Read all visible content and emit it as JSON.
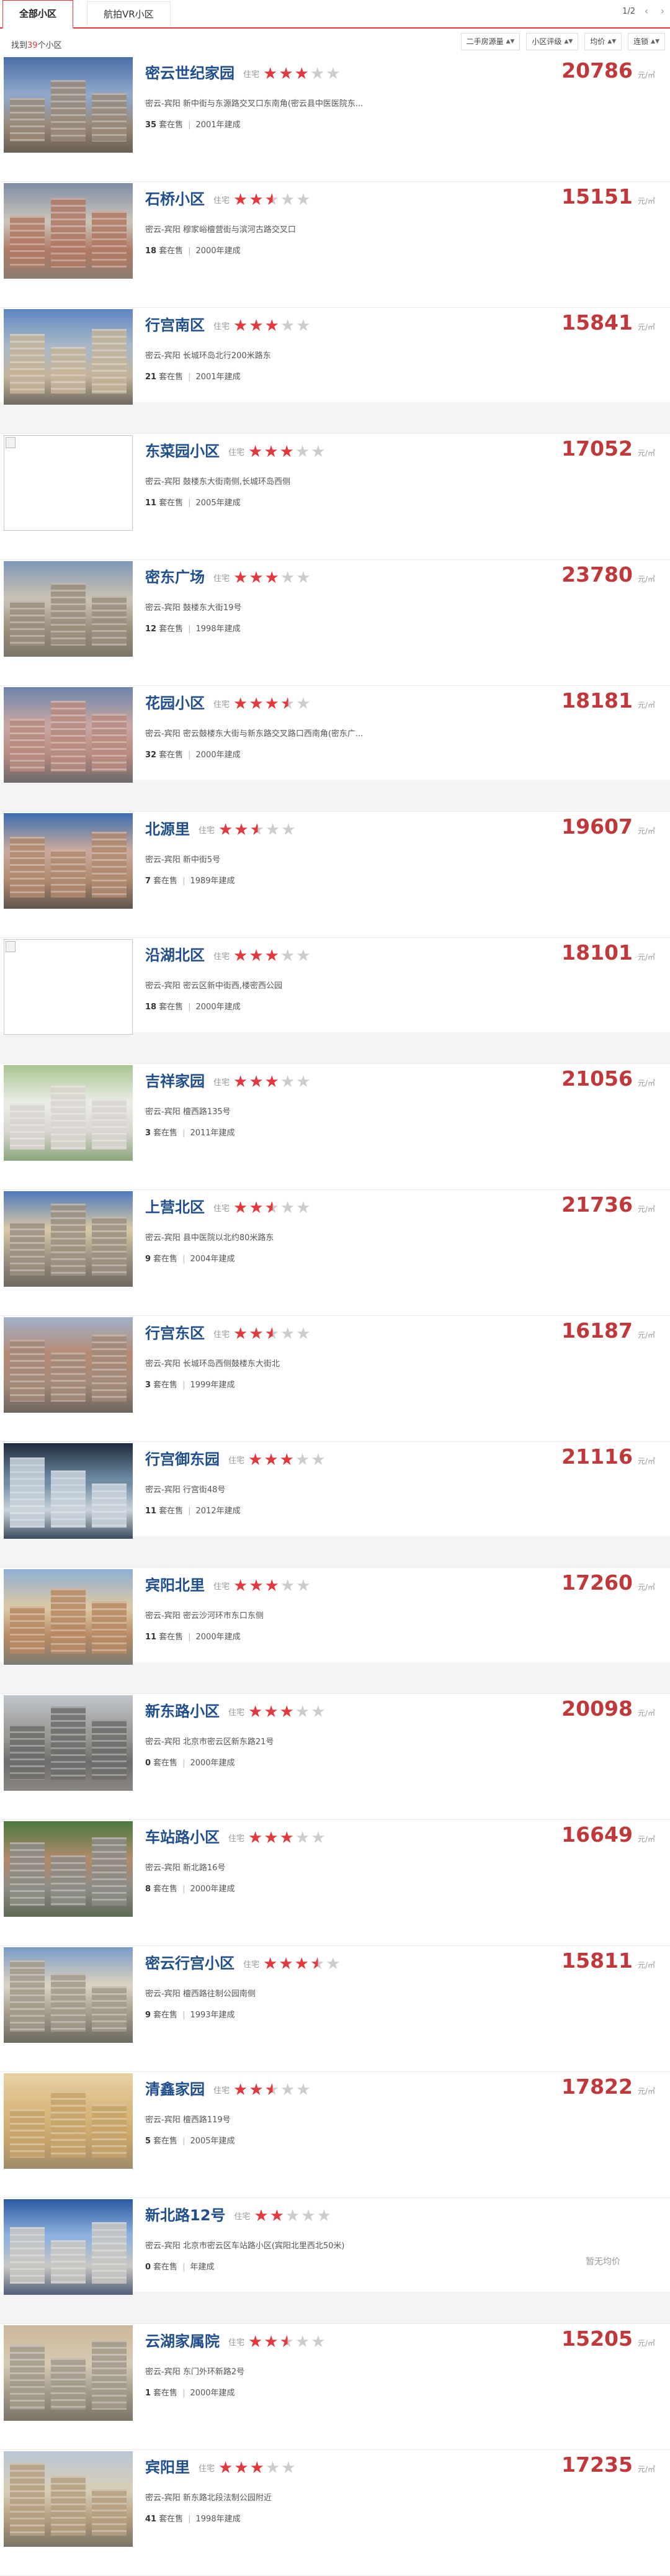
{
  "tabs": [
    {
      "label": "全部小区",
      "active": true
    },
    {
      "label": "航拍VR小区",
      "active": false
    }
  ],
  "pager": {
    "text": "1/2",
    "prev": "‹",
    "next": "›"
  },
  "summary": {
    "prefix": "找到",
    "count": "39",
    "suffix": "个小区"
  },
  "sorts": [
    {
      "label": "二手房源量",
      "icon": "sort-arrows-icon"
    },
    {
      "label": "小区评级",
      "icon": "sort-arrows-icon"
    },
    {
      "label": "均价",
      "icon": "sort-arrows-icon"
    },
    {
      "label": "连锁",
      "icon": "sort-arrows-icon"
    }
  ],
  "price_unit": "元/㎡",
  "listings": [
    {
      "name": "密云世纪家园",
      "type": "住宅",
      "rating": 3,
      "address": "密云-宾阳 新中街与东源路交叉口东南角(密云县中医医院东...",
      "onsale": "35",
      "onsale_label": "套在售",
      "year": "2001年建成",
      "price": "20786",
      "thumb": "photo",
      "palette": [
        "#4a6fa8",
        "#8fa7c9",
        "#9a8a7a",
        "#6b5e52"
      ]
    },
    {
      "name": "石桥小区",
      "type": "住宅",
      "rating": 2.5,
      "address": "密云-宾阳 穆家峪檀营街与滨河古路交叉口",
      "onsale": "18",
      "onsale_label": "套在售",
      "year": "2000年建成",
      "price": "15151",
      "thumb": "photo",
      "palette": [
        "#7d8ea5",
        "#c9c2b8",
        "#b07a66",
        "#8a7d70"
      ]
    },
    {
      "name": "行宫南区",
      "type": "住宅",
      "rating": 3,
      "address": "密云-宾阳 长城环岛北行200米路东",
      "onsale": "21",
      "onsale_label": "套在售",
      "year": "2001年建成",
      "price": "15841",
      "thumb": "photo",
      "palette": [
        "#5e86c2",
        "#a9b8c7",
        "#c4b49a",
        "#6f6b62"
      ]
    },
    {
      "name": "东菜园小区",
      "type": "住宅",
      "rating": 3,
      "address": "密云-宾阳 鼓楼东大街南侧,长城环岛西侧",
      "onsale": "11",
      "onsale_label": "套在售",
      "year": "2005年建成",
      "price": "17052",
      "thumb": "broken",
      "palette": [
        "#ffffff",
        "#ffffff",
        "#ffffff",
        "#ffffff"
      ]
    },
    {
      "name": "密东广场",
      "type": "住宅",
      "rating": 3,
      "address": "密云-宾阳 鼓楼东大街19号",
      "onsale": "12",
      "onsale_label": "套在售",
      "year": "1998年建成",
      "price": "23780",
      "thumb": "photo",
      "palette": [
        "#7f98b7",
        "#c8c1b3",
        "#9c8f7d",
        "#7c7668"
      ]
    },
    {
      "name": "花园小区",
      "type": "住宅",
      "rating": 3.5,
      "address": "密云-宾阳 密云鼓楼东大街与新东路交叉路口西南角(密东广...",
      "onsale": "32",
      "onsale_label": "套在售",
      "year": "2000年建成",
      "price": "18181",
      "thumb": "photo",
      "palette": [
        "#6c84ad",
        "#c6a6a3",
        "#b88b80",
        "#6d6a6c"
      ]
    },
    {
      "name": "北源里",
      "type": "住宅",
      "rating": 2.5,
      "address": "密云-宾阳 新中街5号",
      "onsale": "7",
      "onsale_label": "套在售",
      "year": "1989年建成",
      "price": "19607",
      "thumb": "photo",
      "palette": [
        "#3c6fb2",
        "#c7a89a",
        "#b0896f",
        "#5e564e"
      ]
    },
    {
      "name": "沿湖北区",
      "type": "住宅",
      "rating": 3,
      "address": "密云-宾阳 密云区新中街西,楼密西公园",
      "onsale": "18",
      "onsale_label": "套在售",
      "year": "2000年建成",
      "price": "18101",
      "thumb": "broken",
      "palette": [
        "#ffffff",
        "#ffffff",
        "#ffffff",
        "#ffffff"
      ]
    },
    {
      "name": "吉祥家园",
      "type": "住宅",
      "rating": 3,
      "address": "密云-宾阳 檀西路135号",
      "onsale": "3",
      "onsale_label": "套在售",
      "year": "2011年建成",
      "price": "21056",
      "thumb": "photo",
      "palette": [
        "#a8c590",
        "#e9ece5",
        "#d9d4cf",
        "#88a77a"
      ]
    },
    {
      "name": "上营北区",
      "type": "住宅",
      "rating": 2.5,
      "address": "密云-宾阳 县中医院以北约80米路东",
      "onsale": "9",
      "onsale_label": "套在售",
      "year": "2004年建成",
      "price": "21736",
      "thumb": "photo",
      "palette": [
        "#4f7bbd",
        "#d5c6a4",
        "#9d9181",
        "#6f6960"
      ]
    },
    {
      "name": "行宫东区",
      "type": "住宅",
      "rating": 2.5,
      "address": "密云-宾阳 长城环岛西侧鼓楼东大街北",
      "onsale": "3",
      "onsale_label": "套在售",
      "year": "1999年建成",
      "price": "16187",
      "thumb": "photo",
      "palette": [
        "#9fb3c9",
        "#b68a74",
        "#a48a7a",
        "#6d645c"
      ]
    },
    {
      "name": "行宫御东园",
      "type": "住宅",
      "rating": 3,
      "address": "密云-宾阳 行宫街48号",
      "onsale": "11",
      "onsale_label": "套在售",
      "year": "2012年建成",
      "price": "21116",
      "thumb": "photo",
      "palette": [
        "#1f2c3d",
        "#6e8ca3",
        "#c9d3dc",
        "#3b4d5e"
      ]
    },
    {
      "name": "宾阳北里",
      "type": "住宅",
      "rating": 3,
      "address": "密云-宾阳 密云沙河环市东口东侧",
      "onsale": "11",
      "onsale_label": "套在售",
      "year": "2000年建成",
      "price": "17260",
      "thumb": "photo",
      "palette": [
        "#8fb0d6",
        "#d9c7a5",
        "#b88a63",
        "#7d7b74"
      ]
    },
    {
      "name": "新东路小区",
      "type": "住宅",
      "rating": 3,
      "address": "密云-宾阳 北京市密云区新东路21号",
      "onsale": "0",
      "onsale_label": "套在售",
      "year": "2000年建成",
      "price": "20098",
      "thumb": "photo",
      "palette": [
        "#c0c6cd",
        "#9c9a96",
        "#6f6d6b",
        "#8a8783"
      ]
    },
    {
      "name": "车站路小区",
      "type": "住宅",
      "rating": 3,
      "address": "密云-宾阳 新北路16号",
      "onsale": "8",
      "onsale_label": "套在售",
      "year": "2000年建成",
      "price": "16649",
      "thumb": "photo",
      "palette": [
        "#4a7a3f",
        "#b08a6a",
        "#8e8c86",
        "#5e6a52"
      ]
    },
    {
      "name": "密云行宫小区",
      "type": "住宅",
      "rating": 3.5,
      "address": "密云-宾阳 檀西路往制公园南侧",
      "onsale": "9",
      "onsale_label": "套在售",
      "year": "1993年建成",
      "price": "15811",
      "thumb": "photo",
      "palette": [
        "#7a9cc8",
        "#d8d0c0",
        "#a39a8a",
        "#6c6960"
      ]
    },
    {
      "name": "清鑫家园",
      "type": "住宅",
      "rating": 2.5,
      "address": "密云-宾阳 檀西路119号",
      "onsale": "5",
      "onsale_label": "套在售",
      "year": "2005年建成",
      "price": "17822",
      "thumb": "photo",
      "palette": [
        "#e7d2a5",
        "#d9b77d",
        "#c7a46a",
        "#9e8c6b"
      ]
    },
    {
      "name": "新北路12号",
      "type": "住宅",
      "rating": 2,
      "address": "密云-宾阳 北京市密云区车站路小区(宾阳北里西北50米)",
      "onsale": "0",
      "onsale_label": "套在售",
      "year": "年建成",
      "price": "暂无均价",
      "thumb": "photo",
      "palette": [
        "#2b5aa3",
        "#8fb2de",
        "#c9c7c3",
        "#52607a"
      ]
    },
    {
      "name": "云湖家属院",
      "type": "住宅",
      "rating": 2.5,
      "address": "密云-宾阳 东门外环新路2号",
      "onsale": "1",
      "onsale_label": "套在售",
      "year": "2000年建成",
      "price": "15205",
      "thumb": "photo",
      "palette": [
        "#cbb89c",
        "#d6c9b1",
        "#a39a8a",
        "#7c7466"
      ]
    },
    {
      "name": "宾阳里",
      "type": "住宅",
      "rating": 3,
      "address": "密云-宾阳 新东路北段法制公园附近",
      "onsale": "41",
      "onsale_label": "套在售",
      "year": "1998年建成",
      "price": "17235",
      "thumb": "photo",
      "palette": [
        "#b9c7d6",
        "#d6cdb8",
        "#b59f80",
        "#7b7466"
      ]
    }
  ]
}
